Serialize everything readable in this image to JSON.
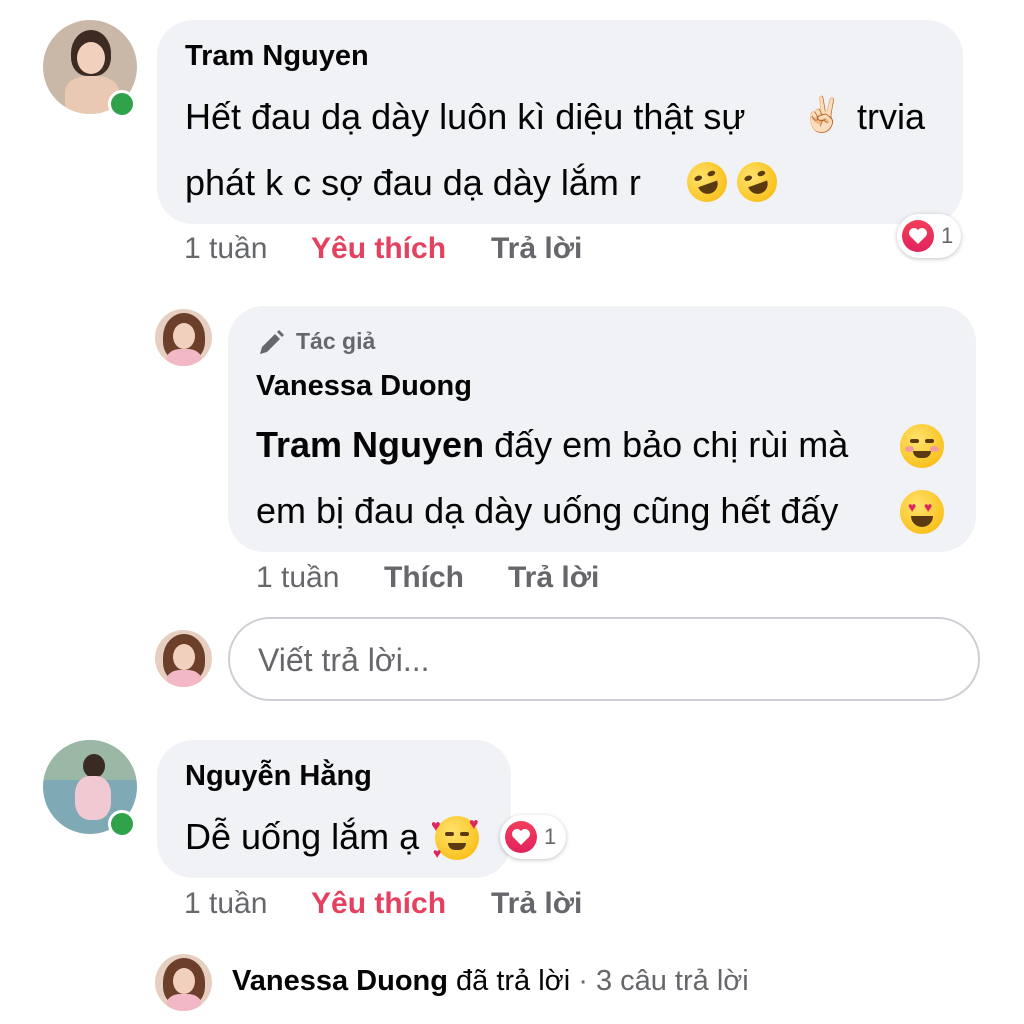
{
  "comments": [
    {
      "author": "Tram Nguyen",
      "text_line1": "Hết đau dạ dày luôn kì diệu thật sự",
      "text_line1_tail": "trvia",
      "text_line2": "phát k c sợ đau dạ dày lắm r",
      "time": "1 tuần",
      "like_label": "Yêu thích",
      "reply_label": "Trả lời",
      "reaction_count": "1",
      "emoji_inline": "✌🏻"
    },
    {
      "author_badge": "Tác giả",
      "author": "Vanessa Duong",
      "mention": "Tram Nguyen",
      "text_line1": " đấy em bảo chị rùi mà",
      "text_line2": "em bị đau dạ dày uống cũng hết đấy",
      "time": "1 tuần",
      "like_label": "Thích",
      "reply_label": "Trả lời"
    },
    {
      "author": "Nguyễn Hằng",
      "text_line1": "Dễ uống lắm ạ",
      "time": "1 tuần",
      "like_label": "Yêu thích",
      "reply_label": "Trả lời",
      "reaction_count": "1"
    }
  ],
  "reply_box": {
    "placeholder": "Viết trả lời..."
  },
  "replies_summary": {
    "author": "Vanessa Duong",
    "action": " đã trả lời",
    "separator": " · ",
    "count": "3 câu trả lời"
  },
  "colors": {
    "bubble": "#f0f2f5",
    "liked": "#e4405f",
    "online": "#31a24c",
    "meta": "#65676b"
  }
}
